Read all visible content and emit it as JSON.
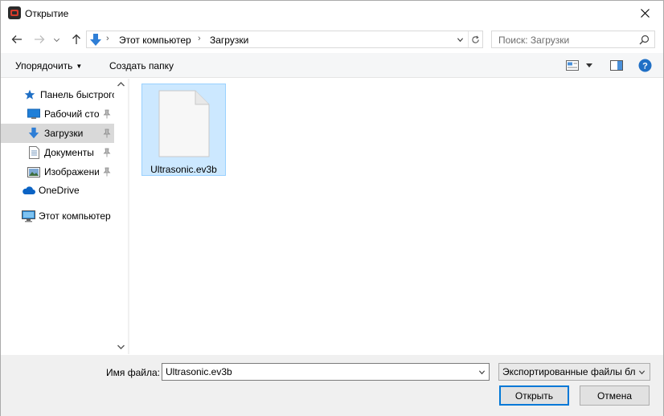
{
  "window": {
    "title": "Открытие"
  },
  "nav": {
    "breadcrumbs": [
      "Этот компьютер",
      "Загрузки"
    ],
    "search_placeholder": "Поиск: Загрузки"
  },
  "commands": {
    "organize_label": "Упорядочить",
    "new_folder_label": "Создать папку"
  },
  "sidebar": {
    "items": [
      {
        "label": "Панель быстрого доступа",
        "icon": "star-icon",
        "pinned": false,
        "selected": false
      },
      {
        "label": "Рабочий стол",
        "icon": "desktop-icon",
        "pinned": true,
        "selected": false
      },
      {
        "label": "Загрузки",
        "icon": "download-arrow-icon",
        "pinned": true,
        "selected": true
      },
      {
        "label": "Документы",
        "icon": "document-icon",
        "pinned": true,
        "selected": false
      },
      {
        "label": "Изображения",
        "icon": "picture-icon",
        "pinned": true,
        "selected": false
      },
      {
        "label": "OneDrive",
        "icon": "cloud-icon",
        "pinned": false,
        "selected": false
      },
      {
        "label": "Этот компьютер",
        "icon": "computer-icon",
        "pinned": false,
        "selected": false
      }
    ]
  },
  "files": [
    {
      "name": "Ultrasonic.ev3b",
      "icon": "blank-file-icon",
      "selected": true
    }
  ],
  "footer": {
    "filename_label": "Имя файла:",
    "filename_value": "Ultrasonic.ev3b",
    "filetype_value": "Экспортированные файлы бл",
    "open_label": "Открыть",
    "cancel_label": "Отмена"
  },
  "colors": {
    "accent": "#0078d7",
    "selection_bg": "#cce8ff",
    "selection_border": "#99d1ff",
    "sidebar_selected_bg": "#d9d9d9",
    "help_icon": "#1f6fc5"
  }
}
